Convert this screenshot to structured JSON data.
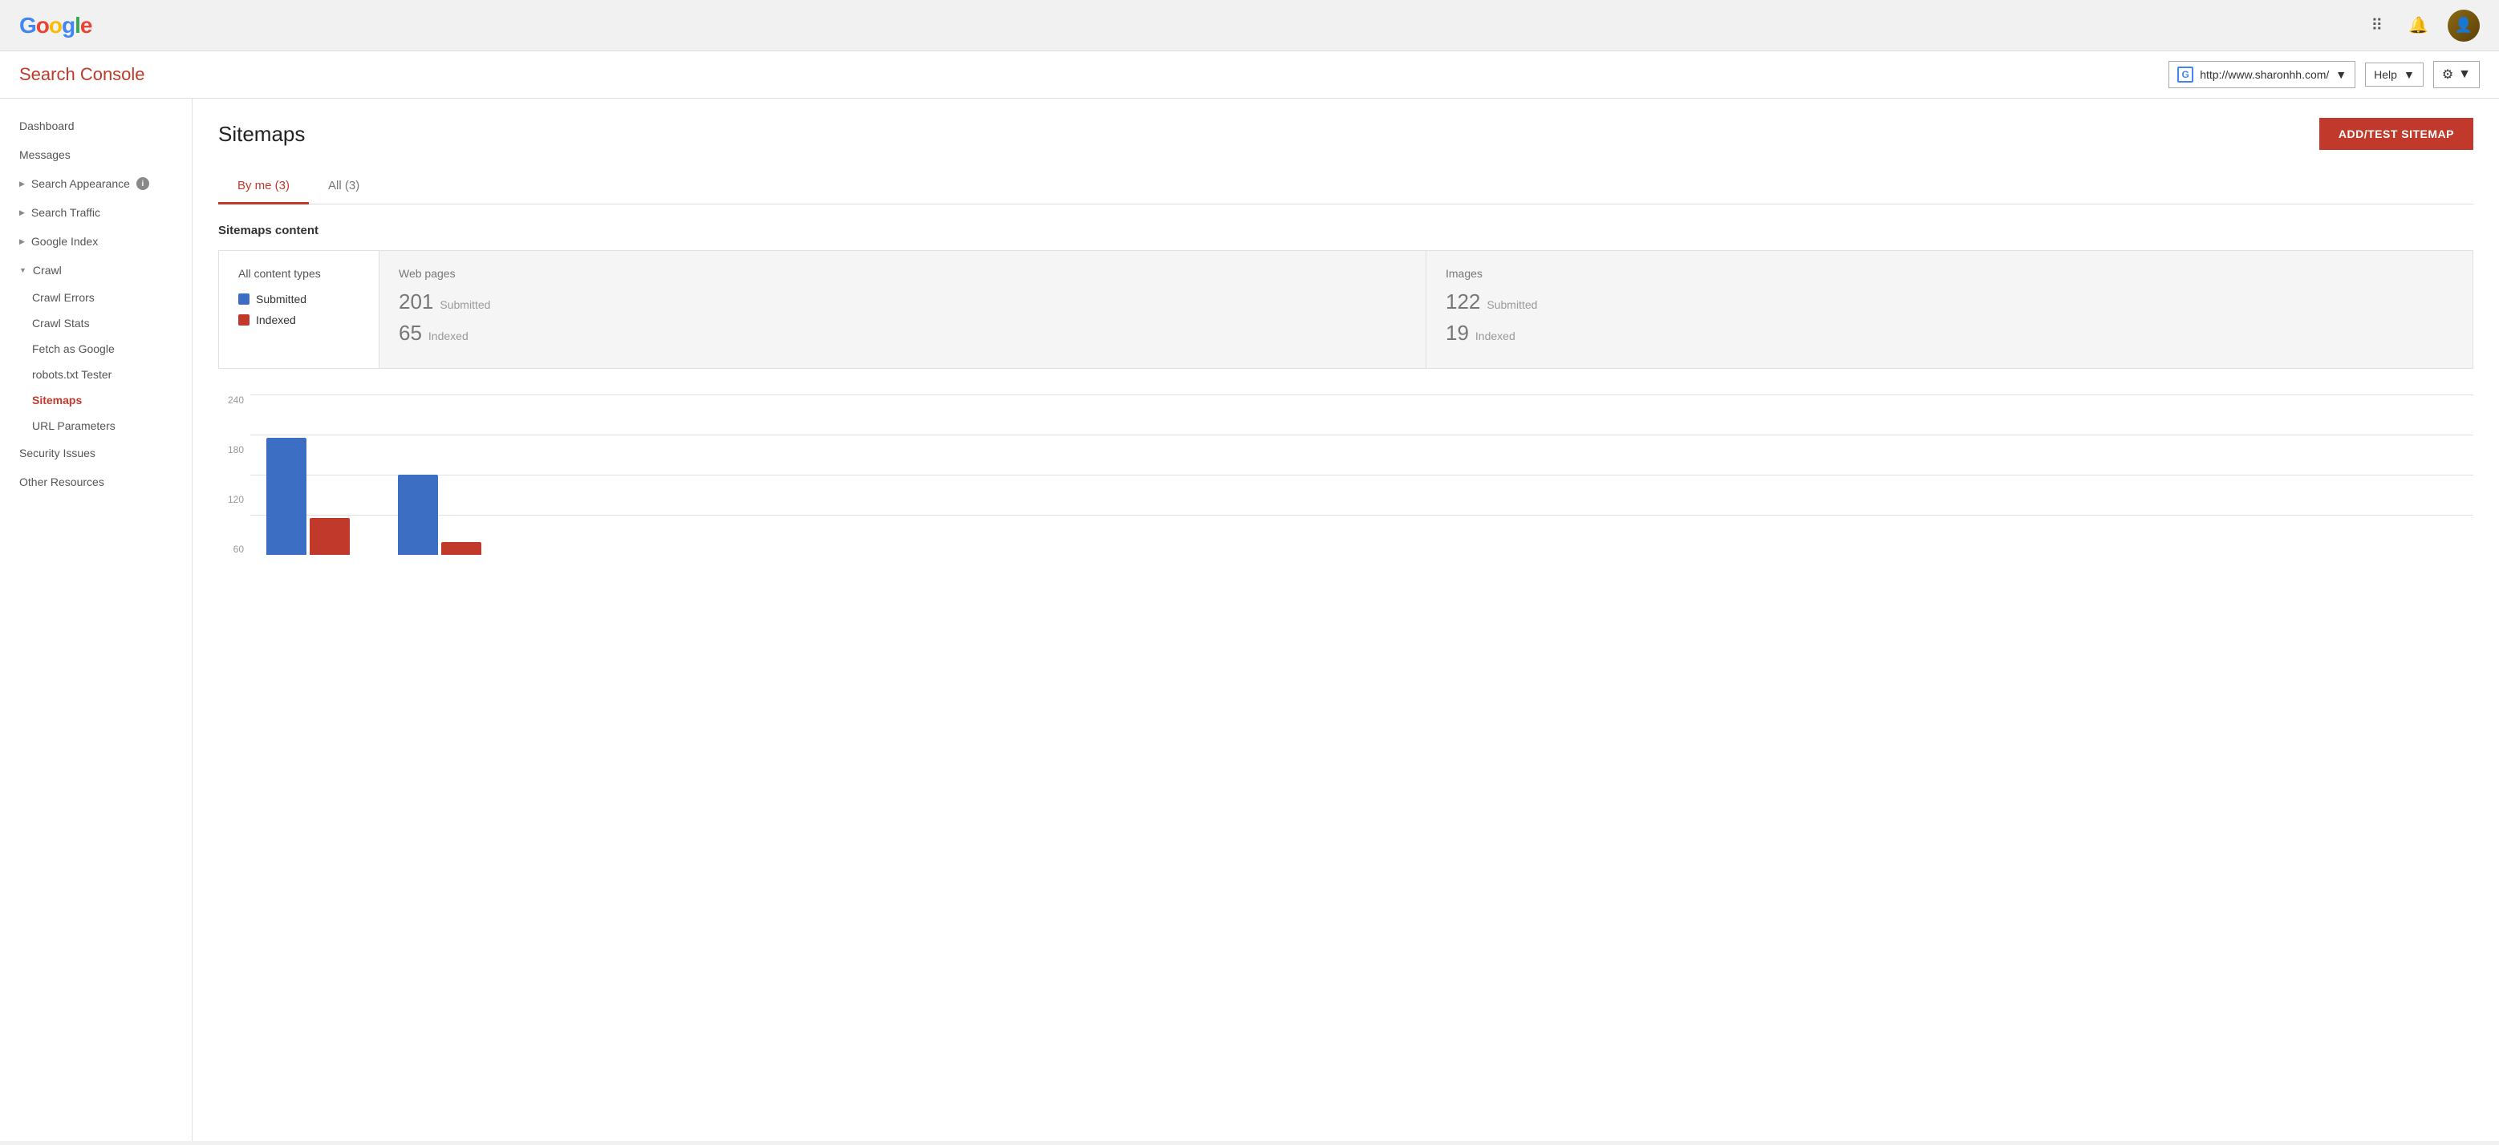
{
  "header": {
    "app_title": "Search Console",
    "site_url": "http://www.sharonhh.com/",
    "help_label": "Help",
    "grid_icon": "⋮⋮⋮",
    "bell_icon": "🔔",
    "gear_icon": "⚙"
  },
  "sidebar": {
    "items": [
      {
        "id": "dashboard",
        "label": "Dashboard",
        "type": "top"
      },
      {
        "id": "messages",
        "label": "Messages",
        "type": "top"
      },
      {
        "id": "search-appearance",
        "label": "Search Appearance",
        "type": "expandable",
        "has_info": true
      },
      {
        "id": "search-traffic",
        "label": "Search Traffic",
        "type": "expandable"
      },
      {
        "id": "google-index",
        "label": "Google Index",
        "type": "expandable"
      },
      {
        "id": "crawl",
        "label": "Crawl",
        "type": "expanded"
      }
    ],
    "sub_items": [
      {
        "id": "crawl-errors",
        "label": "Crawl Errors"
      },
      {
        "id": "crawl-stats",
        "label": "Crawl Stats"
      },
      {
        "id": "fetch-as-google",
        "label": "Fetch as Google"
      },
      {
        "id": "robots-txt",
        "label": "robots.txt Tester"
      },
      {
        "id": "sitemaps",
        "label": "Sitemaps",
        "active": true
      },
      {
        "id": "url-parameters",
        "label": "URL Parameters"
      }
    ],
    "bottom_items": [
      {
        "id": "security-issues",
        "label": "Security Issues"
      },
      {
        "id": "other-resources",
        "label": "Other Resources"
      }
    ]
  },
  "page": {
    "title": "Sitemaps",
    "add_button_label": "ADD/TEST SITEMAP"
  },
  "tabs": [
    {
      "id": "by-me",
      "label": "By me (3)",
      "active": true
    },
    {
      "id": "all",
      "label": "All (3)",
      "active": false
    }
  ],
  "sitemaps_content": {
    "section_title": "Sitemaps content",
    "content_type_label": "All content types",
    "legend": [
      {
        "id": "submitted",
        "label": "Submitted",
        "color": "#3c6fc4"
      },
      {
        "id": "indexed",
        "label": "Indexed",
        "color": "#c0392b"
      }
    ],
    "cards": [
      {
        "id": "web-pages",
        "title": "Web pages",
        "submitted_count": "201",
        "submitted_label": "Submitted",
        "indexed_count": "65",
        "indexed_label": "Indexed"
      },
      {
        "id": "images",
        "title": "Images",
        "submitted_count": "122",
        "submitted_label": "Submitted",
        "indexed_count": "19",
        "indexed_label": "Indexed"
      }
    ]
  },
  "chart": {
    "y_labels": [
      "240",
      "180",
      "120",
      "60"
    ],
    "bars": [
      {
        "id": "bar1",
        "blue_height": 175,
        "red_height": 55
      },
      {
        "id": "bar2",
        "blue_height": 120,
        "red_height": 20
      }
    ],
    "max": 240
  }
}
